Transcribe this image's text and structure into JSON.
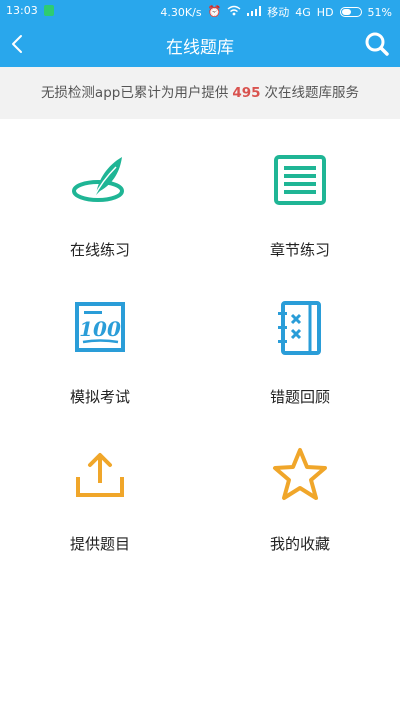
{
  "status_bar": {
    "time": "13:03",
    "net_speed": "4.30K/s",
    "carrier": "移动",
    "network": "4G",
    "hd": "HD",
    "battery": "51%",
    "battery_level": 0.51
  },
  "nav": {
    "title": "在线题库"
  },
  "notice": {
    "prefix": "无损检测app已累计为用户提供",
    "count": "495",
    "suffix": "次在线题库服务"
  },
  "menu": [
    {
      "label": "在线练习",
      "icon": "quill-icon",
      "color": "#1fb595"
    },
    {
      "label": "章节练习",
      "icon": "list-icon",
      "color": "#1fb595"
    },
    {
      "label": "模拟考试",
      "icon": "exam-score-icon",
      "color": "#2a9dd8"
    },
    {
      "label": "错题回顾",
      "icon": "wrong-notebook-icon",
      "color": "#2a9dd8"
    },
    {
      "label": "提供题目",
      "icon": "upload-icon",
      "color": "#f0a62a"
    },
    {
      "label": "我的收藏",
      "icon": "star-icon",
      "color": "#f0a62a"
    }
  ],
  "colors": {
    "primary": "#29a7ec",
    "count_highlight": "#d9534f"
  }
}
